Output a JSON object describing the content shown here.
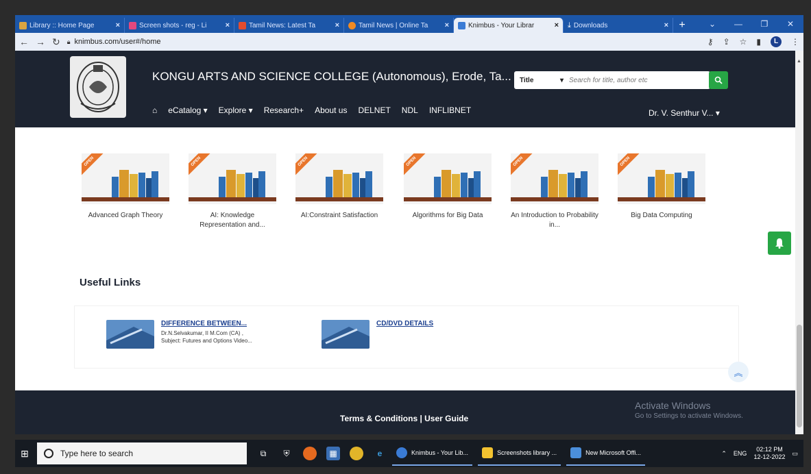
{
  "browser": {
    "tabs": [
      {
        "label": "Library :: Home Page",
        "icon_color": "#d9a441",
        "active": false
      },
      {
        "label": "Screen shots - reg - Li",
        "icon_color": "#e3487e",
        "active": false
      },
      {
        "label": "Tamil News: Latest Ta",
        "icon_color": "#e24c2f",
        "active": false
      },
      {
        "label": "Tamil News | Online Ta",
        "icon_color": "#f08a24",
        "active": false
      },
      {
        "label": "Knimbus - Your Librar",
        "icon_color": "#3a7bd5",
        "active": true
      },
      {
        "label": "Downloads",
        "icon_color": "#dbe6ff",
        "active": false
      }
    ],
    "url": "knimbus.com/user#/home"
  },
  "site": {
    "title": "KONGU ARTS AND SCIENCE COLLEGE (Autonomous), Erode, Ta...",
    "nav": {
      "ecatalog": "eCatalog",
      "explore": "Explore",
      "research": "Research+",
      "about": "About us",
      "delnet": "DELNET",
      "ndl": "NDL",
      "inflibnet": "INFLIBNET"
    },
    "search": {
      "filter": "Title",
      "placeholder": "Search for title, author etc"
    },
    "user": "Dr. V. Senthur V..."
  },
  "books": [
    {
      "title": "Advanced Graph Theory",
      "badge": "OPEN"
    },
    {
      "title": "AI: Knowledge Representation and...",
      "badge": "OPEN"
    },
    {
      "title": "AI:Constraint Satisfaction",
      "badge": "OPEN"
    },
    {
      "title": "Algorithms for Big Data",
      "badge": "OPEN"
    },
    {
      "title": "An Introduction to Probability in...",
      "badge": "OPEN"
    },
    {
      "title": "Big Data Computing",
      "badge": "OPEN"
    }
  ],
  "useful_links": {
    "heading": "Useful Links",
    "items": [
      {
        "title": "DIFFERENCE BETWEEN...",
        "line1": "Dr.N.Selvakumar, II M.Com (CA) ,",
        "line2": "Subject: Futures and Options   Video..."
      },
      {
        "title": "CD/DVD DETAILS",
        "line1": "",
        "line2": ""
      }
    ]
  },
  "footer": {
    "links": "Terms & Conditions | User Guide",
    "watermark_line1": "Activate Windows",
    "watermark_line2": "Go to Settings to activate Windows."
  },
  "taskbar": {
    "search_placeholder": "Type here to search",
    "apps": [
      {
        "label": "Knimbus - Your Lib...",
        "icon_color": "#3a7bd5"
      },
      {
        "label": "Screenshots library ...",
        "icon_color": "#f2c230"
      },
      {
        "label": "New Microsoft Offi...",
        "icon_color": "#4b8fdb"
      }
    ],
    "lang": "ENG",
    "time": "02:12 PM",
    "date": "12-12-2022"
  },
  "colors": {
    "header_bg": "#1d2431",
    "accent_green": "#27a645",
    "ribbon_orange": "#e8762c",
    "chrome_blue": "#1c56a8"
  }
}
